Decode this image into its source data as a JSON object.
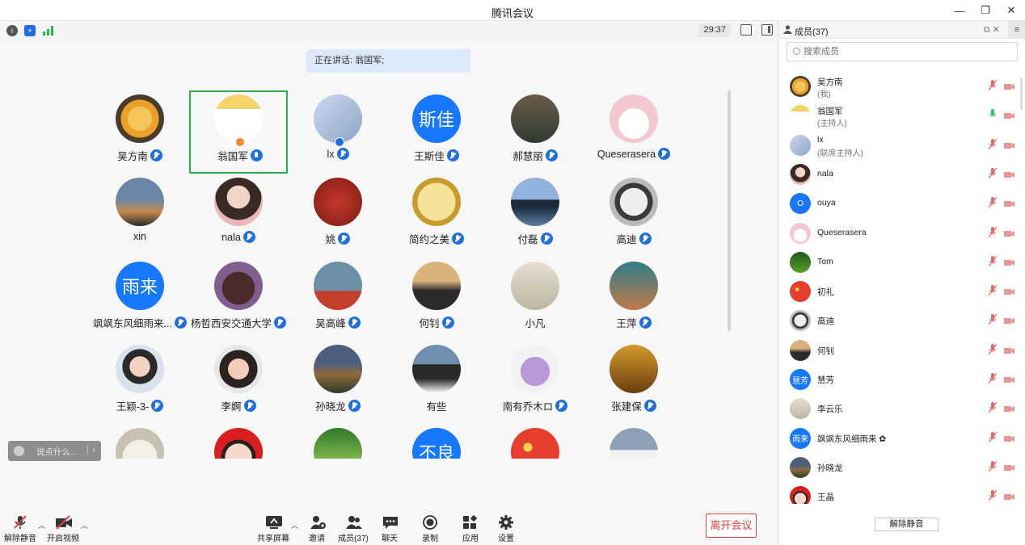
{
  "window": {
    "title": "腾讯会议"
  },
  "status": {
    "timer": "29:37"
  },
  "speaking": "正在讲话: 翁国军;",
  "participants_grid": [
    {
      "name": "吴方南",
      "mic": "muted",
      "av": "dog"
    },
    {
      "name": "翁国军",
      "mic": "on",
      "av": "cartoon",
      "active": true,
      "host": true
    },
    {
      "name": "lx",
      "mic": "muted",
      "av": "couple",
      "cohost": true
    },
    {
      "name": "王斯佳",
      "mic": "muted",
      "av": "text",
      "text": "斯佳"
    },
    {
      "name": "郝慧丽",
      "mic": "muted",
      "av": "group"
    },
    {
      "name": "Queserasera",
      "mic": "muted",
      "av": "girl"
    },
    {
      "name": "xin",
      "mic": "none",
      "av": "sky"
    },
    {
      "name": "nala",
      "mic": "muted",
      "av": "woman"
    },
    {
      "name": "姚",
      "mic": "muted",
      "av": "maple"
    },
    {
      "name": "简约之美",
      "mic": "muted",
      "av": "clock"
    },
    {
      "name": "付磊",
      "mic": "muted",
      "av": "lake"
    },
    {
      "name": "高迪",
      "mic": "muted",
      "av": "astro"
    },
    {
      "name": "飒飒东风细雨来...",
      "mic": "muted",
      "av": "text",
      "text": "雨来"
    },
    {
      "name": "杨哲西安交通大学",
      "mic": "muted",
      "av": "pot"
    },
    {
      "name": "吴高峰",
      "mic": "muted",
      "av": "poster"
    },
    {
      "name": "何钊",
      "mic": "muted",
      "av": "silhouette"
    },
    {
      "name": "小凡",
      "mic": "none",
      "av": "sketch"
    },
    {
      "name": "王萍",
      "mic": "muted",
      "av": "teal"
    },
    {
      "name": "王颖-3-",
      "mic": "muted",
      "av": "kid"
    },
    {
      "name": "李婀",
      "mic": "muted",
      "av": "girl2"
    },
    {
      "name": "孙晓龙",
      "mic": "muted",
      "av": "castle"
    },
    {
      "name": "有些",
      "mic": "none",
      "av": "husky"
    },
    {
      "name": "南有乔木ロ",
      "mic": "muted",
      "av": "anime"
    },
    {
      "name": "张建保",
      "mic": "muted",
      "av": "autumn"
    },
    {
      "name": "",
      "mic": "none",
      "av": "granny"
    },
    {
      "name": "",
      "mic": "none",
      "av": "redkid"
    },
    {
      "name": "",
      "mic": "none",
      "av": "forest"
    },
    {
      "name": "",
      "mic": "none",
      "av": "text",
      "text": "不良"
    },
    {
      "name": "",
      "mic": "none",
      "av": "flag"
    },
    {
      "name": "",
      "mic": "none",
      "av": "cloud"
    }
  ],
  "chat": {
    "placeholder": "说点什么..."
  },
  "toolbar": {
    "unmute": "解除静音",
    "video": "开启视频",
    "share": "共享屏幕",
    "invite": "邀请",
    "members": "成员(37)",
    "chat": "聊天",
    "record": "录制",
    "apps": "应用",
    "settings": "设置",
    "leave": "离开会议"
  },
  "panel": {
    "title": "成员(37)",
    "search_placeholder": "搜索成员",
    "unmute_all": "解除静音",
    "members": [
      {
        "name": "吴方南",
        "role": "(我)",
        "av": "dog",
        "mic": "muted"
      },
      {
        "name": "翁国军",
        "role": "(主持人)",
        "av": "cartoon",
        "mic": "on"
      },
      {
        "name": "lx",
        "role": "(联席主持人)",
        "av": "couple",
        "mic": "muted"
      },
      {
        "name": "nala",
        "role": "",
        "av": "woman",
        "mic": "muted"
      },
      {
        "name": "ouya",
        "role": "",
        "av": "text",
        "text": "O",
        "mic": "muted"
      },
      {
        "name": "Queserasera",
        "role": "",
        "av": "girl",
        "mic": "muted"
      },
      {
        "name": "Tom",
        "role": "",
        "av": "green",
        "mic": "muted"
      },
      {
        "name": "初礼",
        "role": "",
        "av": "flag",
        "mic": "muted"
      },
      {
        "name": "高迪",
        "role": "",
        "av": "astro",
        "mic": "muted"
      },
      {
        "name": "何钊",
        "role": "",
        "av": "silhouette",
        "mic": "muted"
      },
      {
        "name": "慧芳",
        "role": "",
        "av": "text",
        "text": "慧芳",
        "mic": "muted"
      },
      {
        "name": "李云乐",
        "role": "",
        "av": "sketch",
        "mic": "muted"
      },
      {
        "name": "飒飒东风细雨来 ✿",
        "role": "",
        "av": "text",
        "text": "雨来",
        "mic": "muted"
      },
      {
        "name": "孙晓龙",
        "role": "",
        "av": "castle",
        "mic": "muted"
      },
      {
        "name": "王晶",
        "role": "",
        "av": "redkid",
        "mic": "muted"
      }
    ]
  },
  "colors": {
    "accent": "#1677ff",
    "active_border": "#2ab24a",
    "leave": "#e64340",
    "mic_on": "#33c155",
    "muted": "#e06a6a"
  }
}
